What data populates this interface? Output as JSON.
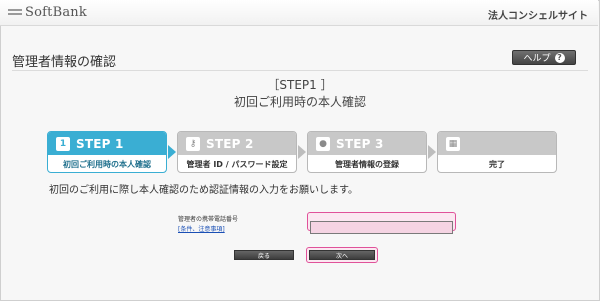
{
  "header": {
    "logo_text": "SoftBank",
    "site_name": "法人コンシェルサイト"
  },
  "page": {
    "title": "管理者情報の確認",
    "help_label": "ヘルプ",
    "help_icon": "?"
  },
  "step_heading": {
    "step": "［STEP1 ］",
    "subtitle": "初回ご利用時の本人確認"
  },
  "steps": [
    {
      "number": "STEP 1",
      "label": "初回ご利用時の本人確認",
      "icon": "id-card-icon",
      "glyph": "1",
      "active": true
    },
    {
      "number": "STEP 2",
      "label": "管理者 ID / パスワード設定",
      "icon": "key-icon",
      "glyph": "⚷",
      "active": false
    },
    {
      "number": "STEP 3",
      "label": "管理者情報の登録",
      "icon": "person-icon",
      "glyph": "●",
      "active": false
    },
    {
      "number": "",
      "label": "完了",
      "icon": "checkered-flag-icon",
      "glyph": "▦",
      "active": false
    }
  ],
  "instruction": "初回のご利用に際し本人確認のため認証情報の入力をお願いします。",
  "form": {
    "field_label": "管理者の携帯電話番号",
    "field_link": "[条件、注意事項]",
    "phone_value": ""
  },
  "buttons": {
    "back": "戻る",
    "next": "次へ"
  },
  "colors": {
    "active_step": "#3aaed3",
    "highlight": "#e0529a"
  }
}
